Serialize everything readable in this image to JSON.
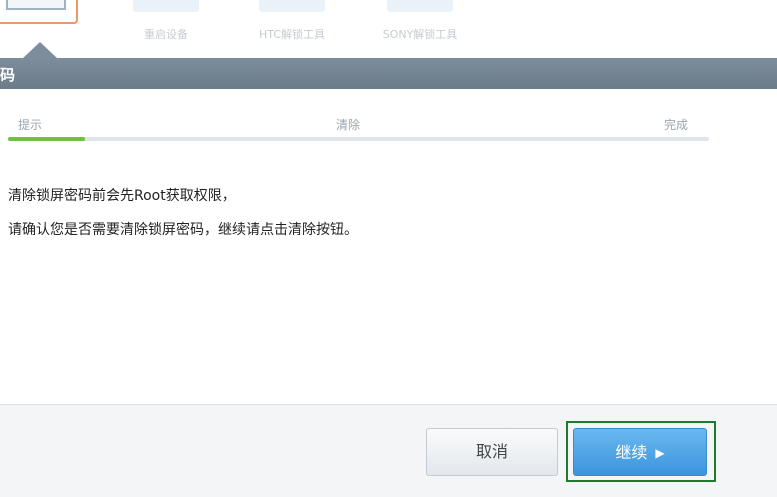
{
  "tools": [
    {
      "label": ""
    },
    {
      "label": "重启设备"
    },
    {
      "label": "HTC解锁工具"
    },
    {
      "label": "SONY解锁工具"
    }
  ],
  "header": {
    "title": "码"
  },
  "steps": {
    "tip": "提示",
    "clear": "清除",
    "done": "完成"
  },
  "progress": {
    "fraction": 0.11
  },
  "message": {
    "line1": "清除锁屏密码前会先Root获取权限，",
    "line2": "请确认您是否需要清除锁屏密码，继续请点击清除按钮。"
  },
  "buttons": {
    "cancel": "取消",
    "continue": "继续",
    "continue_arrow": "▶"
  }
}
